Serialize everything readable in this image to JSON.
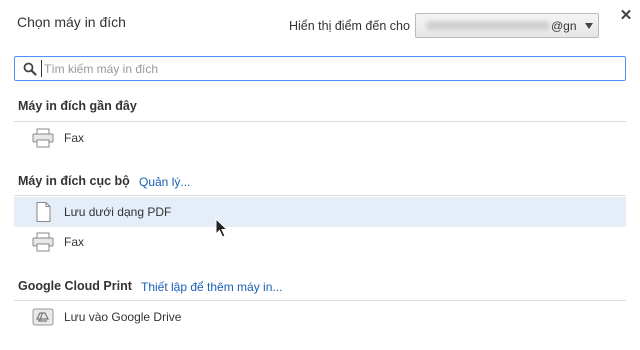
{
  "dialog": {
    "title": "Chọn máy in đích",
    "close_icon": "close-icon"
  },
  "destination": {
    "label": "Hiển thị điểm đến cho",
    "account_suffix": "@gn"
  },
  "search": {
    "placeholder": "Tìm kiếm máy in đích",
    "value": ""
  },
  "recent": {
    "header": "Máy in đích gần đây",
    "items": [
      {
        "label": "Fax",
        "icon": "printer-icon"
      }
    ]
  },
  "local": {
    "header": "Máy in đích cục bộ",
    "manage_link": "Quản lý...",
    "items": [
      {
        "label": "Lưu dưới dạng PDF",
        "icon": "document-icon",
        "highlighted": true
      },
      {
        "label": "Fax",
        "icon": "printer-icon"
      }
    ]
  },
  "cloud": {
    "header": "Google Cloud Print",
    "setup_link": "Thiết lập để thêm máy in...",
    "items": [
      {
        "label": "Lưu vào Google Drive",
        "icon": "google-drive-icon"
      }
    ]
  },
  "colors": {
    "accent": "#4d90fe",
    "link": "#1a5fb4",
    "highlight": "#e5edf9"
  }
}
